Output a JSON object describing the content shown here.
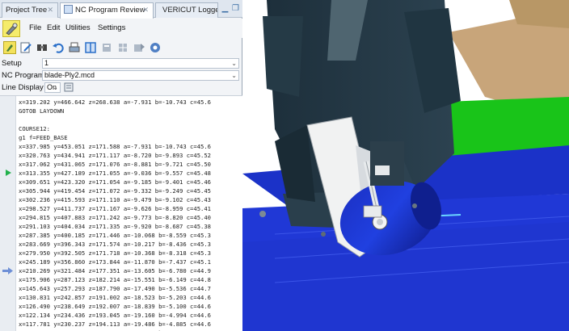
{
  "tabs": [
    {
      "label": "Project Tree"
    },
    {
      "label": "NC Program Review"
    },
    {
      "label": "VERICUT Logger"
    }
  ],
  "menu": {
    "items": [
      "File",
      "Edit",
      "Utilities",
      "Settings"
    ]
  },
  "toolbar": {
    "icons": [
      "vericut-icon",
      "edit-icon",
      "find-icon",
      "undo-icon",
      "print-icon",
      "layout-icon",
      "text-icon",
      "grid-icon",
      "report-icon",
      "settings-icon"
    ]
  },
  "setup": {
    "label": "Setup",
    "value": "1"
  },
  "nc_program": {
    "label": "NC Program",
    "value": "blade-Ply2.mcd"
  },
  "line_display": {
    "label": "Line Display",
    "value": "On"
  },
  "code_lines": [
    "x=319.202 y=466.642 z=268.638 a=-7.931 b=-10.743 c=45.6",
    "GOTOB LAYDOWN",
    "",
    "COURSE12:",
    "g1 f=FEED_BASE",
    "x=337.985 y=453.051 z=171.588 a=-7.931 b=-10.743 c=45.6",
    "x=320.763 y=434.941 z=171.117 a=-8.720 b=-9.893 c=45.52",
    "x=317.062 y=431.065 z=171.076 a=-8.881 b=-9.721 c=45.50",
    "x=313.355 y=427.189 z=171.055 a=-9.036 b=-9.557 c=45.48",
    "x=309.651 y=423.320 z=171.054 a=-9.185 b=-9.401 c=45.46",
    "x=305.944 y=419.454 z=171.072 a=-9.332 b=-9.249 c=45.45",
    "x=302.236 y=415.593 z=171.110 a=-9.479 b=-9.102 c=45.43",
    "x=298.527 y=411.737 z=171.167 a=-9.626 b=-8.959 c=45.41",
    "x=294.815 y=407.883 z=171.242 a=-9.773 b=-8.820 c=45.40",
    "x=291.103 y=404.034 z=171.335 a=-9.920 b=-8.687 c=45.38",
    "x=287.385 y=400.185 z=171.446 a=-10.068 b=-8.559 c=45.3",
    "x=283.669 y=396.343 z=171.574 a=-10.217 b=-8.436 c=45.3",
    "x=279.950 y=392.505 z=171.718 a=-10.368 b=-8.318 c=45.3",
    "x=245.189 y=356.860 z=173.844 a=-11.870 b=-7.437 c=45.1",
    "x=210.269 y=321.484 z=177.351 a=-13.605 b=-6.780 c=44.9",
    "x=175.906 y=287.123 z=182.214 a=-15.551 b=-6.149 c=44.8",
    "x=145.643 y=257.293 z=187.790 a=-17.490 b=-5.536 c=44.7",
    "x=130.831 y=242.857 z=191.002 a=-18.523 b=-5.203 c=44.6",
    "x=126.490 y=238.649 z=192.007 a=-18.839 b=-5.100 c=44.6",
    "x=122.134 y=234.436 z=193.045 a=-19.160 b=-4.994 c=44.6",
    "x=117.781 y=230.237 z=194.113 a=-19.486 b=-4.885 c=44.6",
    "x=113.415 y=226.037 z=195.217 a=-19.815 b=-4.777 c=44.6",
    "x=109.047 y=221.848 z=196.354 a=-20.153 b=-4.663 c=44.6"
  ],
  "markers": {
    "play_line": 8,
    "current_line": 19,
    "play_color": "#22b14c",
    "current_color": "#6d8fd6"
  },
  "colors": {
    "tab_bg": "#dfe6ef",
    "panel_bg": "#f2f4f7",
    "viewport_blue": "#1f33c6",
    "viewport_green": "#19c419"
  }
}
